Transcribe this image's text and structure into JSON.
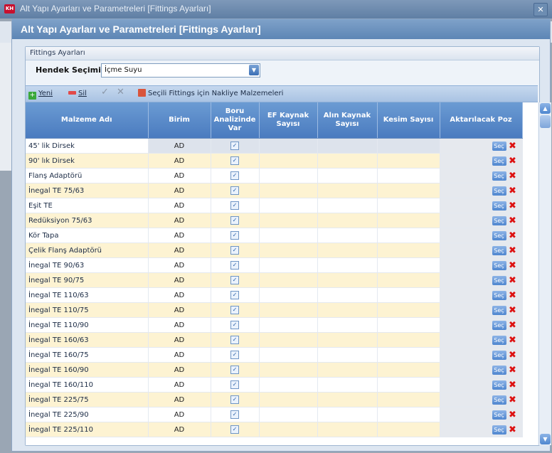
{
  "window": {
    "title": "Alt Yapı Ayarları ve Parametreleri [Fittings Ayarları]",
    "icon_text": "KH"
  },
  "header": {
    "title": "Alt Yapı Ayarları ve Parametreleri [Fittings Ayarları]"
  },
  "group": {
    "title": "Fittings Ayarları"
  },
  "hendek": {
    "label": "Hendek Seçimi :",
    "value": "İçme Suyu"
  },
  "toolbar": {
    "yeni": "Yeni",
    "sil": "Sil",
    "nakliye": "Seçili Fittings için Nakliye Malzemeleri"
  },
  "columns": [
    "Malzeme Adı",
    "Birim",
    "Boru Analizinde Var",
    "EF Kaynak Sayısı",
    "Alın Kaynak Sayısı",
    "Kesim Sayısı",
    "Aktarılacak Poz"
  ],
  "row_button": "Seç",
  "rows": [
    {
      "name": "45' lik Dirsek",
      "unit": "AD"
    },
    {
      "name": "90' lık Dirsek",
      "unit": "AD"
    },
    {
      "name": "Flanş Adaptörü",
      "unit": "AD"
    },
    {
      "name": "İnegal TE 75/63",
      "unit": "AD"
    },
    {
      "name": "Eşit TE",
      "unit": "AD"
    },
    {
      "name": "Redüksiyon 75/63",
      "unit": "AD"
    },
    {
      "name": "Kör Tapa",
      "unit": "AD"
    },
    {
      "name": "Çelik Flanş Adaptörü",
      "unit": "AD"
    },
    {
      "name": "İnegal TE 90/63",
      "unit": "AD"
    },
    {
      "name": "İnegal TE 90/75",
      "unit": "AD"
    },
    {
      "name": "İnegal TE 110/63",
      "unit": "AD"
    },
    {
      "name": "İnegal TE 110/75",
      "unit": "AD"
    },
    {
      "name": "İnegal TE 110/90",
      "unit": "AD"
    },
    {
      "name": "İnegal TE 160/63",
      "unit": "AD"
    },
    {
      "name": "İnegal TE 160/75",
      "unit": "AD"
    },
    {
      "name": "İnegal TE 160/90",
      "unit": "AD"
    },
    {
      "name": "İnegal TE 160/110",
      "unit": "AD"
    },
    {
      "name": "İnegal TE 225/75",
      "unit": "AD"
    },
    {
      "name": "İnegal TE 225/90",
      "unit": "AD"
    },
    {
      "name": "İnegal TE 225/110",
      "unit": "AD"
    }
  ]
}
